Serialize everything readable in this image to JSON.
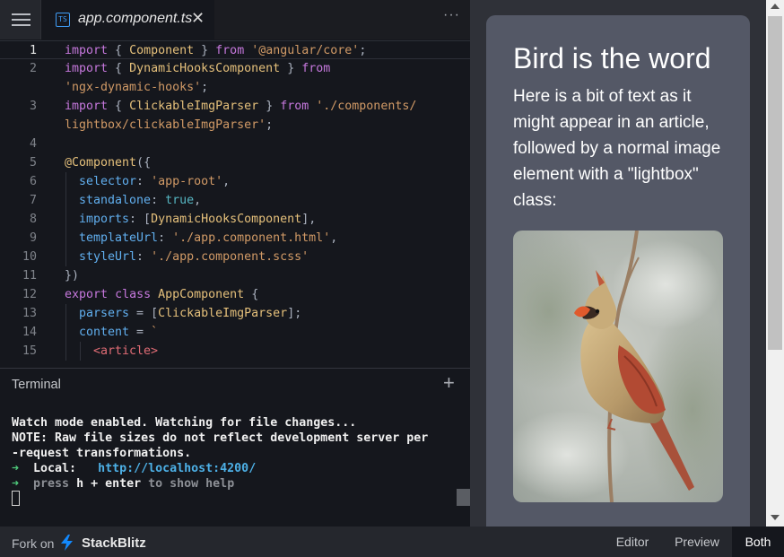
{
  "editor": {
    "tab_label": "app.component.ts",
    "ts_badge": "TS",
    "close_glyph": "✕",
    "more_glyph": "···",
    "lines": [
      {
        "n": "1",
        "active": true,
        "indent": 0,
        "tokens": [
          [
            "k",
            "import"
          ],
          [
            "p",
            " { "
          ],
          [
            "c",
            "Component"
          ],
          [
            "p",
            " } "
          ],
          [
            "k",
            "from"
          ],
          [
            "p",
            " "
          ],
          [
            "s",
            "'@angular/core'"
          ],
          [
            "p",
            ";"
          ]
        ]
      },
      {
        "n": "2",
        "active": false,
        "indent": 0,
        "tokens": [
          [
            "k",
            "import"
          ],
          [
            "p",
            " { "
          ],
          [
            "c",
            "DynamicHooksComponent"
          ],
          [
            "p",
            " } "
          ],
          [
            "k",
            "from"
          ]
        ]
      },
      {
        "n": "",
        "active": false,
        "indent": 0,
        "tokens": [
          [
            "s",
            "'ngx-dynamic-hooks'"
          ],
          [
            "p",
            ";"
          ]
        ]
      },
      {
        "n": "3",
        "active": false,
        "indent": 0,
        "tokens": [
          [
            "k",
            "import"
          ],
          [
            "p",
            " { "
          ],
          [
            "c",
            "ClickableImgParser"
          ],
          [
            "p",
            " } "
          ],
          [
            "k",
            "from"
          ],
          [
            "p",
            " "
          ],
          [
            "s",
            "'./components/"
          ]
        ]
      },
      {
        "n": "",
        "active": false,
        "indent": 0,
        "tokens": [
          [
            "s",
            "lightbox/clickableImgParser'"
          ],
          [
            "p",
            ";"
          ]
        ]
      },
      {
        "n": "4",
        "active": false,
        "indent": 0,
        "tokens": []
      },
      {
        "n": "5",
        "active": false,
        "indent": 0,
        "tokens": [
          [
            "c",
            "@Component"
          ],
          [
            "p",
            "({"
          ]
        ]
      },
      {
        "n": "6",
        "active": false,
        "indent": 1,
        "tokens": [
          [
            "pr",
            "selector"
          ],
          [
            "p",
            ": "
          ],
          [
            "s",
            "'app-root'"
          ],
          [
            "p",
            ","
          ]
        ]
      },
      {
        "n": "7",
        "active": false,
        "indent": 1,
        "tokens": [
          [
            "pr",
            "standalone"
          ],
          [
            "p",
            ": "
          ],
          [
            "b",
            "true"
          ],
          [
            "p",
            ","
          ]
        ]
      },
      {
        "n": "8",
        "active": false,
        "indent": 1,
        "tokens": [
          [
            "pr",
            "imports"
          ],
          [
            "p",
            ": ["
          ],
          [
            "c",
            "DynamicHooksComponent"
          ],
          [
            "p",
            "],"
          ]
        ]
      },
      {
        "n": "9",
        "active": false,
        "indent": 1,
        "tokens": [
          [
            "pr",
            "templateUrl"
          ],
          [
            "p",
            ": "
          ],
          [
            "s",
            "'./app.component.html'"
          ],
          [
            "p",
            ","
          ]
        ]
      },
      {
        "n": "10",
        "active": false,
        "indent": 1,
        "tokens": [
          [
            "pr",
            "styleUrl"
          ],
          [
            "p",
            ": "
          ],
          [
            "s",
            "'./app.component.scss'"
          ]
        ]
      },
      {
        "n": "11",
        "active": false,
        "indent": 0,
        "tokens": [
          [
            "p",
            "})"
          ]
        ]
      },
      {
        "n": "12",
        "active": false,
        "indent": 0,
        "tokens": [
          [
            "k",
            "export"
          ],
          [
            "p",
            " "
          ],
          [
            "k",
            "class"
          ],
          [
            "p",
            " "
          ],
          [
            "c",
            "AppComponent"
          ],
          [
            "p",
            " {"
          ]
        ]
      },
      {
        "n": "13",
        "active": false,
        "indent": 1,
        "tokens": [
          [
            "pr",
            "parsers"
          ],
          [
            "p",
            " = ["
          ],
          [
            "c",
            "ClickableImgParser"
          ],
          [
            "p",
            "];"
          ]
        ]
      },
      {
        "n": "14",
        "active": false,
        "indent": 1,
        "tokens": [
          [
            "pr",
            "content"
          ],
          [
            "p",
            " = "
          ],
          [
            "s",
            "`"
          ]
        ]
      },
      {
        "n": "15",
        "active": false,
        "indent": 2,
        "tokens": [
          [
            "t",
            "<article>"
          ]
        ]
      }
    ]
  },
  "terminal": {
    "title": "Terminal",
    "plus_glyph": "+",
    "lines": [
      "Watch mode enabled. Watching for file changes...",
      "NOTE: Raw file sizes do not reflect development server per",
      "-request transformations."
    ],
    "local_arrow": "➜",
    "local_label": "  Local:   ",
    "local_url": "http://localhost:4200/",
    "help_arrow": "➜",
    "help_pre": "  press ",
    "help_key": "h + enter",
    "help_post": " to show help"
  },
  "preview": {
    "heading": "Bird is the word",
    "paragraph": "Here is a bit of text as it might appear in an article, followed by a normal image element with a \"lightbox\" class:",
    "image_subject": "northern-cardinal-bird",
    "colors": {
      "card": "#545866",
      "background": "#2f3138"
    }
  },
  "footer": {
    "fork_label": "Fork on",
    "brand": "StackBlitz",
    "buttons": {
      "editor": "Editor",
      "preview": "Preview",
      "both": "Both"
    },
    "active_view": "Both",
    "colors": {
      "bolt": "#1389fd"
    }
  }
}
